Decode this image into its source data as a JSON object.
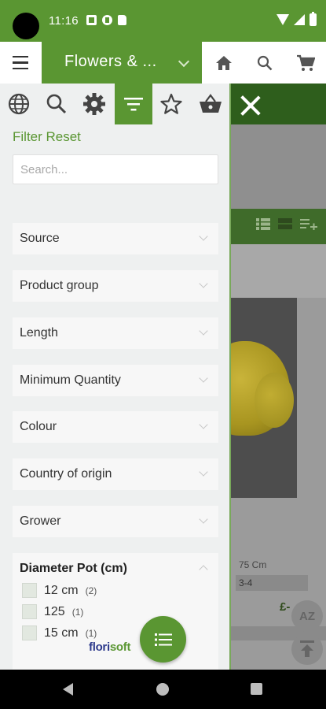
{
  "status_bar": {
    "time": "11:16"
  },
  "app_bar": {
    "title": "Flowers & ..."
  },
  "product_view": {
    "length": "75 Cm",
    "range": "3-4",
    "price": "£-",
    "sort_label": "AZ"
  },
  "filter_panel": {
    "reset_label": "Filter Reset",
    "search_placeholder": "Search...",
    "facets": [
      {
        "label": "Source"
      },
      {
        "label": "Product group"
      },
      {
        "label": "Length"
      },
      {
        "label": "Minimum Quantity"
      },
      {
        "label": "Colour"
      },
      {
        "label": "Country of origin"
      },
      {
        "label": "Grower"
      }
    ],
    "open_facet": {
      "label": "Diameter Pot (cm)",
      "options": [
        {
          "label": "12 cm",
          "count": "(2)"
        },
        {
          "label": "125",
          "count": "(1)"
        },
        {
          "label": "15 cm",
          "count": "(1)"
        }
      ]
    }
  },
  "branding": {
    "logo_part1": "flori",
    "logo_part2": "soft"
  },
  "colors": {
    "primary_green": "#5a9632",
    "dark_green": "#2e5e1c"
  },
  "icons": [
    "globe-icon",
    "search-icon",
    "gear-icon",
    "filter-icon",
    "star-icon",
    "basket-icon",
    "home-icon",
    "cart-icon",
    "menu-icon",
    "close-icon",
    "list-icon",
    "to-top-icon"
  ]
}
